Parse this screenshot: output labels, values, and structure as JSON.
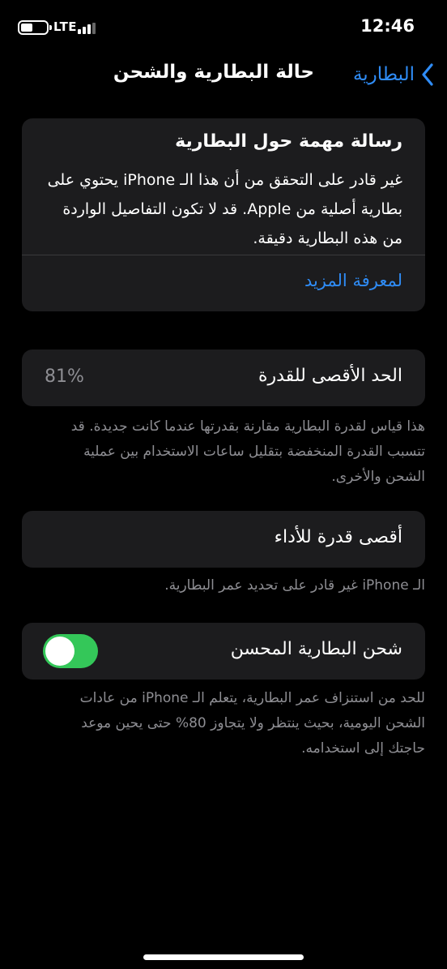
{
  "status_bar": {
    "network": "LTE",
    "time": "12:46"
  },
  "nav": {
    "title": "حالة البطارية والشحن",
    "back_label": "البطارية"
  },
  "message_card": {
    "title": "رسالة مهمة حول البطارية",
    "body": "غير قادر على التحقق من أن هذا الـ iPhone يحتوي على بطارية أصلية من Apple. قد لا تكون التفاصيل الواردة من هذه البطارية دقيقة.",
    "learn_more": "لمعرفة المزيد"
  },
  "maximum_capacity": {
    "label": "الحد الأقصى للقدرة",
    "value": "81%",
    "footnote": "هذا قياس لقدرة البطارية مقارنة بقدرتها عندما كانت جديدة. قد تتسبب القدرة المنخفضة بتقليل ساعات الاستخدام بين عملية الشحن والأخرى."
  },
  "peak_performance": {
    "label": "أقصى قدرة للأداء",
    "footnote": "الـ iPhone غير قادر على تحديد عمر البطارية."
  },
  "optimized_charging": {
    "label": "شحن البطارية المحسن",
    "enabled": true,
    "toggle_color": "#34c759",
    "footnote": "للحد من استنزاف عمر البطارية، يتعلم الـ iPhone من عادات الشحن اليومية، بحيث ينتظر ولا يتجاوز 80% حتى يحين موعد حاجتك إلى استخدامه."
  },
  "colors": {
    "accent": "#2f8cf6",
    "card_bg": "#1c1c1e",
    "secondary_text": "#8e8e93"
  },
  "icons": {
    "battery": "battery-icon",
    "signal": "signal-icon",
    "back": "chevron-left-icon"
  }
}
